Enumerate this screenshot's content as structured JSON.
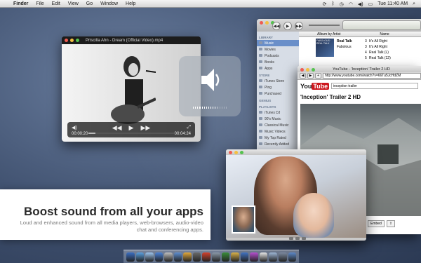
{
  "menubar": {
    "app_name": "Finder",
    "items": [
      "File",
      "Edit",
      "View",
      "Go",
      "Window",
      "Help"
    ],
    "clock": "Tue 11:40 AM"
  },
  "player": {
    "title": "Priscilla Ahn - Dream (Official Video).mp4",
    "time_elapsed": "00:00:20",
    "time_remaining": "00:04:24",
    "progress_fraction": 0.08
  },
  "volume_hud": {
    "level_fraction": 0.7,
    "icon": "speaker-icon"
  },
  "itunes": {
    "sidebar": {
      "library_heading": "LIBRARY",
      "library_items": [
        "Music",
        "Movies",
        "Podcasts",
        "Books",
        "Apps"
      ],
      "store_heading": "STORE",
      "store_items": [
        "iTunes Store",
        "Ping",
        "Purchased"
      ],
      "genius_heading": "GENIUS",
      "playlists_heading": "PLAYLISTS",
      "playlists": [
        "iTunes DJ",
        "90's Music",
        "Classical Music",
        "Music Videos",
        "My Top Rated",
        "Recently Added"
      ]
    },
    "columns": {
      "album": "Album by Artist",
      "name": "Name"
    },
    "album": {
      "art_text": "FABOLOUS · REAL TALK",
      "title": "Real Talk",
      "artist": "Fabolous"
    },
    "tracks": [
      {
        "num": "3",
        "name": "It's All Right"
      },
      {
        "num": "3",
        "name": "It's All Right"
      },
      {
        "num": "4",
        "name": "Real Talk (L)"
      },
      {
        "num": "5",
        "name": "Real Talk (12)"
      }
    ]
  },
  "browser": {
    "title": "YouTube - 'Inception' Trailer 2 HD",
    "url": "http://www.youtube.com/watch?v=66Tu5JcHdZM",
    "logo_you": "You",
    "logo_tube": "Tube",
    "search_value": "inception trailer",
    "video_title": "'Inception' Trailer 2 HD",
    "embed_label": "Embed"
  },
  "promo": {
    "headline": "Boost sound from all your apps",
    "body": "Loud and enhanced sound from all media players, web-browsers, audio-video chat and conferencing apps."
  },
  "dock": {
    "icon_colors": [
      "#3a6fc4",
      "#5aa0e0",
      "#9ec6ef",
      "#4b82d6",
      "#c0c0c0",
      "#5f8fd0",
      "#e2a93c",
      "#6b6b6b",
      "#d3412f",
      "#8c9aa9",
      "#3b8f3b",
      "#d9b14a",
      "#4273c2",
      "#b64fd0",
      "#e8e8e8",
      "#9fb7d6",
      "#7c8aa0",
      "#5d89c8"
    ]
  },
  "colors": {
    "close": "#ee5c52",
    "minimize": "#f4c041",
    "zoom": "#55c24e",
    "youtube_red": "#cc181e",
    "itunes_selection": "#6a8fc9"
  }
}
